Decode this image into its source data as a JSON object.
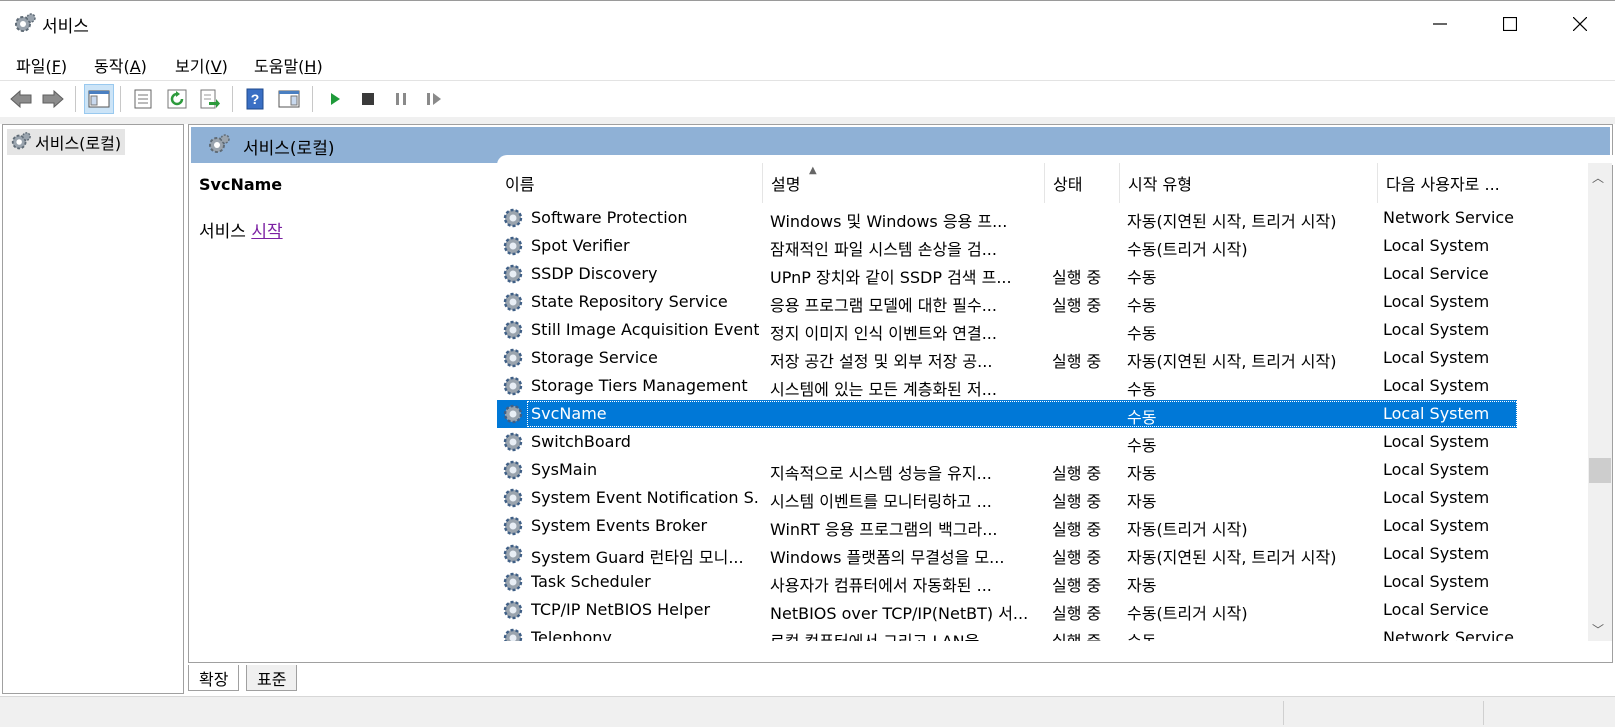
{
  "window": {
    "title": "서비스"
  },
  "menu": [
    {
      "label": "파일",
      "key": "F"
    },
    {
      "label": "동작",
      "key": "A"
    },
    {
      "label": "보기",
      "key": "V"
    },
    {
      "label": "도움말",
      "key": "H"
    }
  ],
  "tree": {
    "root": "서비스(로컬)"
  },
  "pane": {
    "header": "서비스(로컬)",
    "selected_name": "SvcName",
    "action_prefix": "서비스",
    "action_link": "시작"
  },
  "table": {
    "columns": [
      "이름",
      "설명",
      "상태",
      "시작 유형",
      "다음 사용자로 ..."
    ],
    "rows": [
      {
        "name": "Software Protection",
        "desc": "Windows 및 Windows 응용 프...",
        "status": "",
        "start": "자동(지연된 시작, 트리거 시작)",
        "logon": "Network Service"
      },
      {
        "name": "Spot Verifier",
        "desc": "잠재적인 파일 시스템 손상을 검...",
        "status": "",
        "start": "수동(트리거 시작)",
        "logon": "Local System"
      },
      {
        "name": "SSDP Discovery",
        "desc": "UPnP 장치와 같이 SSDP 검색 프...",
        "status": "실행 중",
        "start": "수동",
        "logon": "Local Service"
      },
      {
        "name": "State Repository Service",
        "desc": "응용 프로그램 모델에 대한 필수...",
        "status": "실행 중",
        "start": "수동",
        "logon": "Local System"
      },
      {
        "name": "Still Image Acquisition Events",
        "desc": "정지 이미지 인식 이벤트와 연결...",
        "status": "",
        "start": "수동",
        "logon": "Local System"
      },
      {
        "name": "Storage Service",
        "desc": "저장 공간 설정 및 외부 저장 공...",
        "status": "실행 중",
        "start": "자동(지연된 시작, 트리거 시작)",
        "logon": "Local System"
      },
      {
        "name": "Storage Tiers Management",
        "desc": "시스템에 있는 모든 계층화된 저...",
        "status": "",
        "start": "수동",
        "logon": "Local System"
      },
      {
        "name": "SvcName",
        "desc": "",
        "status": "",
        "start": "수동",
        "logon": "Local System",
        "selected": true
      },
      {
        "name": "SwitchBoard",
        "desc": "",
        "status": "",
        "start": "수동",
        "logon": "Local System"
      },
      {
        "name": "SysMain",
        "desc": "지속적으로 시스템 성능을 유지...",
        "status": "실행 중",
        "start": "자동",
        "logon": "Local System"
      },
      {
        "name": "System Event Notification S...",
        "desc": "시스템 이벤트를 모니터링하고 ...",
        "status": "실행 중",
        "start": "자동",
        "logon": "Local System"
      },
      {
        "name": "System Events Broker",
        "desc": "WinRT 응용 프로그램의 백그라...",
        "status": "실행 중",
        "start": "자동(트리거 시작)",
        "logon": "Local System"
      },
      {
        "name": "System Guard 런타임 모니...",
        "desc": "Windows 플랫폼의 무결성을 모...",
        "status": "실행 중",
        "start": "자동(지연된 시작, 트리거 시작)",
        "logon": "Local System"
      },
      {
        "name": "Task Scheduler",
        "desc": "사용자가 컴퓨터에서 자동화된 ...",
        "status": "실행 중",
        "start": "자동",
        "logon": "Local System"
      },
      {
        "name": "TCP/IP NetBIOS Helper",
        "desc": "NetBIOS over TCP/IP(NetBT) 서...",
        "status": "실행 중",
        "start": "수동(트리거 시작)",
        "logon": "Local Service"
      },
      {
        "name": "Telephony",
        "desc": "로컬 컴퓨터에서 그리고 LAN을 ...",
        "status": "실행 중",
        "start": "수동",
        "logon": "Network Service"
      }
    ]
  },
  "tabs": [
    "확장",
    "표준"
  ],
  "colors": {
    "selection": "#0078d7",
    "header_band": "#8fb1d6",
    "link": "#7b1fa2"
  }
}
